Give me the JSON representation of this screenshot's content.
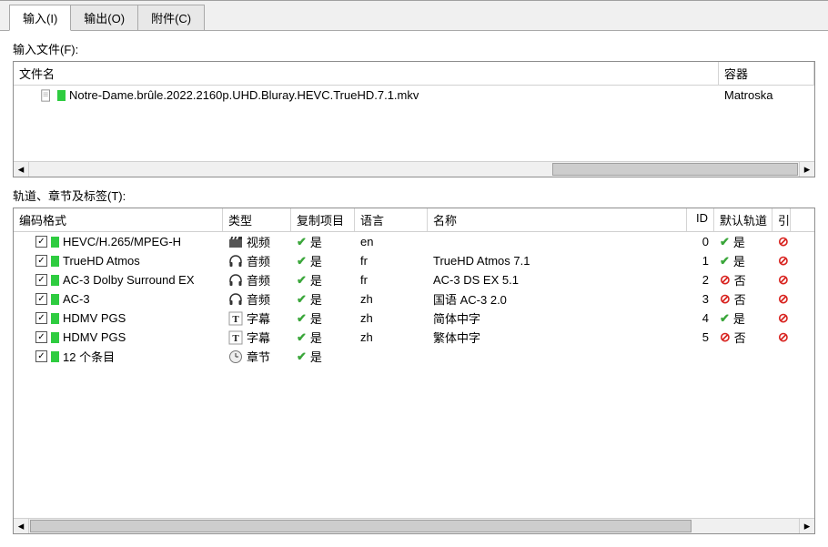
{
  "tabs": {
    "input": "输入(I)",
    "output": "输出(O)",
    "attach": "附件(C)"
  },
  "labels": {
    "input_files": "输入文件(F):",
    "tracks_chapters_tags": "轨道、章节及标签(T):"
  },
  "file_cols": {
    "filename": "文件名",
    "container": "容器"
  },
  "files": [
    {
      "name": "Notre-Dame.brûle.2022.2160p.UHD.Bluray.HEVC.TrueHD.7.1.mkv",
      "container": "Matroska"
    }
  ],
  "track_cols": {
    "codec": "编码格式",
    "type": "类型",
    "copy": "复制项目",
    "lang": "语言",
    "name": "名称",
    "id": "ID",
    "default": "默认轨道"
  },
  "vals": {
    "yes": "是",
    "no": "否",
    "video": "视频",
    "audio": "音频",
    "subtitle": "字幕",
    "chapters": "章节"
  },
  "tracks": [
    {
      "checked": true,
      "codec": "HEVC/H.265/MPEG-H",
      "type_key": "video",
      "type_icon": "clapper",
      "copy": "yes",
      "lang": "en",
      "name": "",
      "id": "0",
      "default": "yes"
    },
    {
      "checked": true,
      "codec": "TrueHD Atmos",
      "type_key": "audio",
      "type_icon": "headphones",
      "copy": "yes",
      "lang": "fr",
      "name": "TrueHD Atmos 7.1",
      "id": "1",
      "default": "yes"
    },
    {
      "checked": true,
      "codec": "AC-3 Dolby Surround EX",
      "type_key": "audio",
      "type_icon": "headphones",
      "copy": "yes",
      "lang": "fr",
      "name": "AC-3 DS EX 5.1",
      "id": "2",
      "default": "no"
    },
    {
      "checked": true,
      "codec": "AC-3",
      "type_key": "audio",
      "type_icon": "headphones",
      "copy": "yes",
      "lang": "zh",
      "name": "国语 AC-3 2.0",
      "id": "3",
      "default": "no"
    },
    {
      "checked": true,
      "codec": "HDMV PGS",
      "type_key": "subtitle",
      "type_icon": "text",
      "copy": "yes",
      "lang": "zh",
      "name": "简体中字",
      "id": "4",
      "default": "yes"
    },
    {
      "checked": true,
      "codec": "HDMV PGS",
      "type_key": "subtitle",
      "type_icon": "text",
      "copy": "yes",
      "lang": "zh",
      "name": "繁体中字",
      "id": "5",
      "default": "no"
    },
    {
      "checked": true,
      "codec": "12 个条目",
      "type_key": "chapters",
      "type_icon": "clock",
      "copy": "yes",
      "lang": "",
      "name": "",
      "id": "",
      "default": ""
    }
  ]
}
